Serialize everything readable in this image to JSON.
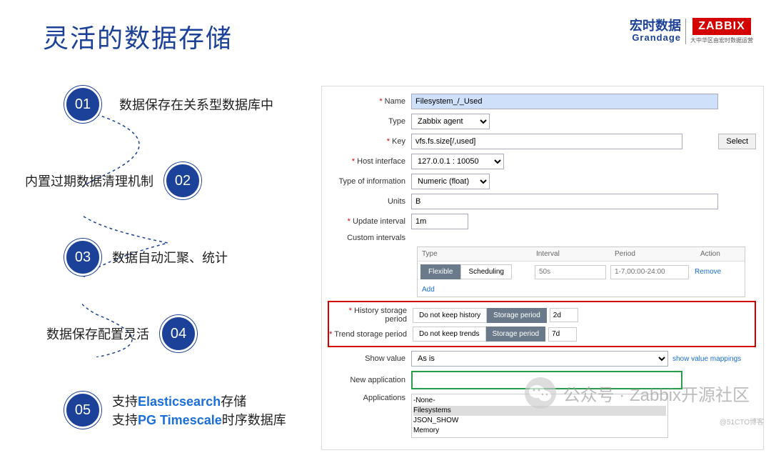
{
  "header": {
    "title": "灵活的数据存储",
    "grandage_cn": "宏时数据",
    "grandage_en": "Grandage",
    "zabbix": "ZABBIX",
    "zabbix_sub": "大中华区由宏时数据运营"
  },
  "bullets": {
    "b1_num": "01",
    "b1_text": "数据保存在关系型数据库中",
    "b2_num": "02",
    "b2_text": "内置过期数据清理机制",
    "b3_num": "03",
    "b3_text": "数据自动汇聚、统计",
    "b4_num": "04",
    "b4_text": "数据保存配置灵活",
    "b5_num": "05",
    "b5_line1a": "支持",
    "b5_es": "Elasticsearch",
    "b5_line1b": "存储",
    "b5_line2a": "支持",
    "b5_pg": "PG Timescale",
    "b5_line2b": "时序数据库"
  },
  "form": {
    "name_label": "Name",
    "name_value": "Filesystem_/_Used",
    "type_label": "Type",
    "type_value": "Zabbix agent",
    "key_label": "Key",
    "key_value": "vfs.fs.size[/,used]",
    "key_btn": "Select",
    "host_label": "Host interface",
    "host_value": "127.0.0.1 : 10050",
    "info_label": "Type of information",
    "info_value": "Numeric (float)",
    "units_label": "Units",
    "units_value": "B",
    "upd_label": "Update interval",
    "upd_value": "1m",
    "ci_label": "Custom intervals",
    "ci_h_type": "Type",
    "ci_h_int": "Interval",
    "ci_h_per": "Period",
    "ci_h_act": "Action",
    "ci_flex": "Flexible",
    "ci_sched": "Scheduling",
    "ci_int_ph": "50s",
    "ci_per_ph": "1-7,00:00-24:00",
    "ci_rem": "Remove",
    "ci_add": "Add",
    "hist_label": "History storage period",
    "hist_opt1": "Do not keep history",
    "hist_opt2": "Storage period",
    "hist_val": "2d",
    "trend_label": "Trend storage period",
    "trend_opt1": "Do not keep trends",
    "trend_opt2": "Storage period",
    "trend_val": "7d",
    "show_label": "Show value",
    "show_value": "As is",
    "show_link": "show value mappings",
    "newapp_label": "New application",
    "apps_label": "Applications",
    "apps": {
      "a0": "-None-",
      "a1": "Filesystems",
      "a2": "JSON_SHOW",
      "a3": "Memory"
    }
  },
  "watermark": {
    "text": "公众号 · Zabbix开源社区",
    "footer": "@51CTO博客"
  }
}
